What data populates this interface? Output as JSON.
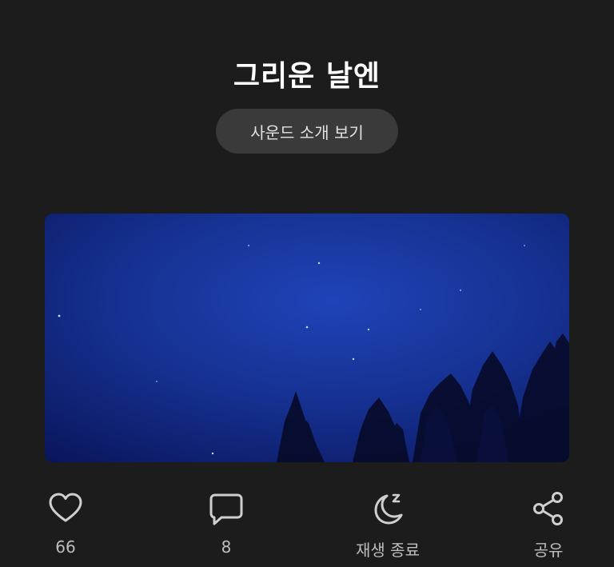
{
  "header": {
    "title": "그리운 날엔",
    "intro_button_label": "사운드 소개 보기"
  },
  "artwork": {
    "description_icon": "night-sky-artwork"
  },
  "actions": {
    "like": {
      "icon": "heart-icon",
      "label": "66"
    },
    "comment": {
      "icon": "comment-icon",
      "label": "8"
    },
    "sleep_timer": {
      "icon": "moon-sleep-icon",
      "label": "재생 종료"
    },
    "share": {
      "icon": "share-icon",
      "label": "공유"
    }
  },
  "colors": {
    "background": "#1c1c1c",
    "button_bg": "#3a3a3a",
    "icon": "#cfcfcf",
    "label": "#bdbdbd"
  }
}
